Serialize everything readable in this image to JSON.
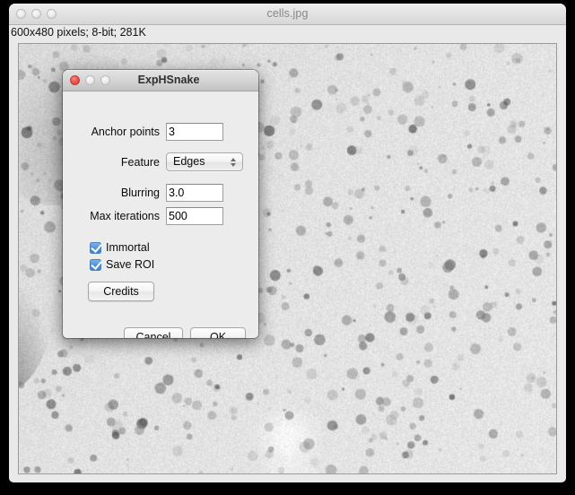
{
  "window": {
    "title": "cells.jpg",
    "status": "600x480 pixels; 8-bit; 281K",
    "traffic_lights": [
      "close-button",
      "minimize-button",
      "zoom-button"
    ]
  },
  "dialog": {
    "title": "ExpHSnake",
    "fields": [
      {
        "label": "Anchor points",
        "value": "3",
        "type": "text"
      },
      {
        "label": "Feature",
        "value": "Edges",
        "type": "select"
      },
      {
        "label": "Blurring",
        "value": "3.0",
        "type": "text"
      },
      {
        "label": "Max iterations",
        "value": "500",
        "type": "text"
      }
    ],
    "checkboxes": [
      {
        "label": "Immortal",
        "checked": true
      },
      {
        "label": "Save ROI",
        "checked": true
      }
    ],
    "buttons": {
      "credits": "Credits",
      "cancel": "Cancel",
      "ok": "OK"
    }
  },
  "colors": {
    "accent_checkbox": "#4e93de",
    "close_button": "#f25b52",
    "window_chrome": "#e9e9e9",
    "dialog_body": "#ececec"
  }
}
